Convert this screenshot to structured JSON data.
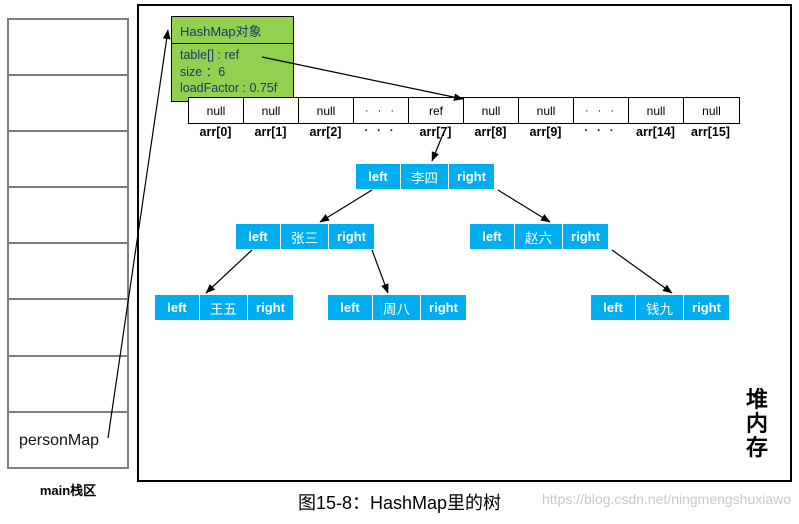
{
  "stack": {
    "caption": "main栈区",
    "cells": [
      {
        "label": ""
      },
      {
        "label": ""
      },
      {
        "label": ""
      },
      {
        "label": ""
      },
      {
        "label": ""
      },
      {
        "label": ""
      },
      {
        "label": ""
      },
      {
        "label": "personMap"
      }
    ]
  },
  "heap": {
    "label_chars": [
      "堆",
      "内",
      "存"
    ]
  },
  "hashmap_object": {
    "title": "HashMap对象",
    "fields": [
      "table[] : ref",
      "size ：6",
      "loadFactor : 0.75f"
    ]
  },
  "array": {
    "cells": [
      "null",
      "null",
      "null",
      "· · ·",
      "ref",
      "null",
      "null",
      "· · ·",
      "null",
      "null"
    ],
    "labels": [
      "arr[0]",
      "arr[1]",
      "arr[2]",
      "· · ·",
      "arr[7]",
      "arr[8]",
      "arr[9]",
      "· · ·",
      "arr[14]",
      "arr[15]"
    ]
  },
  "tree": {
    "left_label": "left",
    "right_label": "right",
    "nodes": [
      {
        "id": "root",
        "value": "李四"
      },
      {
        "id": "l1",
        "value": "张三"
      },
      {
        "id": "r1",
        "value": "赵六"
      },
      {
        "id": "l2a",
        "value": "王五"
      },
      {
        "id": "l2b",
        "value": "周八"
      },
      {
        "id": "r2",
        "value": "钱九"
      }
    ]
  },
  "caption": "图15-8：HashMap里的树",
  "watermark": "https://blog.csdn.net/ningmengshuxiawo",
  "colors": {
    "node_blue": "#00AEEF",
    "hashmap_green": "#92D050",
    "hashmap_text": "#1F3864",
    "stack_border": "#808080",
    "heap_border": "#000000"
  }
}
